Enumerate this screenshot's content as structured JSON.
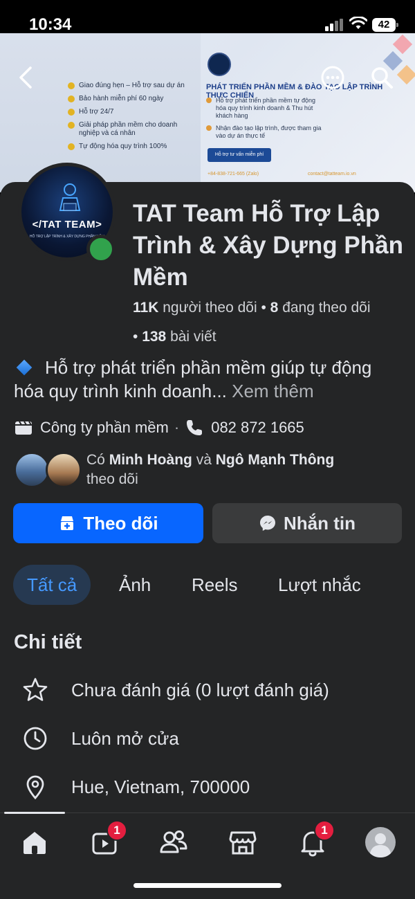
{
  "status_bar": {
    "time": "10:34",
    "battery": "42"
  },
  "cover": {
    "bullets": [
      "Giao đúng hẹn – Hỗ trợ sau dự án",
      "Bảo hành miễn phí 60 ngày",
      "Hỗ trợ 24/7",
      "Giải pháp phần mềm cho doanh nghiệp và cá nhân",
      "Tự động hóa quy trình 100%"
    ],
    "headline": "PHÁT TRIỂN PHẦN MỀM & ĐÀO TẠO LẬP TRÌNH THỰC CHIẾN",
    "items": [
      "Hỗ trợ phát triển phần mềm tự động hóa quy trình kinh doanh & Thu hút khách hàng",
      "Nhận đào tạo lập trình, được tham gia vào dự án thực tế"
    ],
    "cta": "Hỗ trợ tư vấn miễn phí",
    "phone": "+84-838-721-665 (Zalo)",
    "email": "contact@tatteam.io.vn"
  },
  "avatar": {
    "title": "</TAT TEAM>",
    "subtitle": "HỖ TRỢ LẬP TRÌNH & XÂY DỰNG PHẦN MỀM"
  },
  "page": {
    "title": "TAT Team Hỗ Trợ Lập Trình & Xây Dựng Phần Mềm",
    "followers_count": "11K",
    "followers_label": "người theo dõi",
    "following_count": "8",
    "following_label": "đang theo dõi",
    "posts_count": "138",
    "posts_label": "bài viết"
  },
  "bio": {
    "text": "Hỗ trợ phát triển phần mềm giúp tự động hóa quy trình kinh doanh...",
    "more": "Xem thêm"
  },
  "info": {
    "category": "Công ty phần mềm",
    "phone": "082 872 1665"
  },
  "mutual": {
    "prefix": "Có",
    "name1": "Minh Hoàng",
    "conj": "và",
    "name2": "Ngô Mạnh Thông",
    "suffix": "theo dõi"
  },
  "buttons": {
    "follow": "Theo dõi",
    "message": "Nhắn tin"
  },
  "tabs": [
    "Tất cả",
    "Ảnh",
    "Reels",
    "Lượt nhắc"
  ],
  "details": {
    "title": "Chi tiết",
    "rating": "Chưa đánh giá (0 lượt đánh giá)",
    "hours": "Luôn mở cửa",
    "location": "Hue, Vietnam, 700000"
  },
  "nav": {
    "video_badge": "1",
    "notifications_badge": "1"
  },
  "colors": {
    "primary": "#0866ff",
    "panel": "#242526",
    "online": "#31a24c",
    "badge": "#e41e3f",
    "tab_active_bg": "#263951",
    "tab_active_text": "#4599ff"
  }
}
